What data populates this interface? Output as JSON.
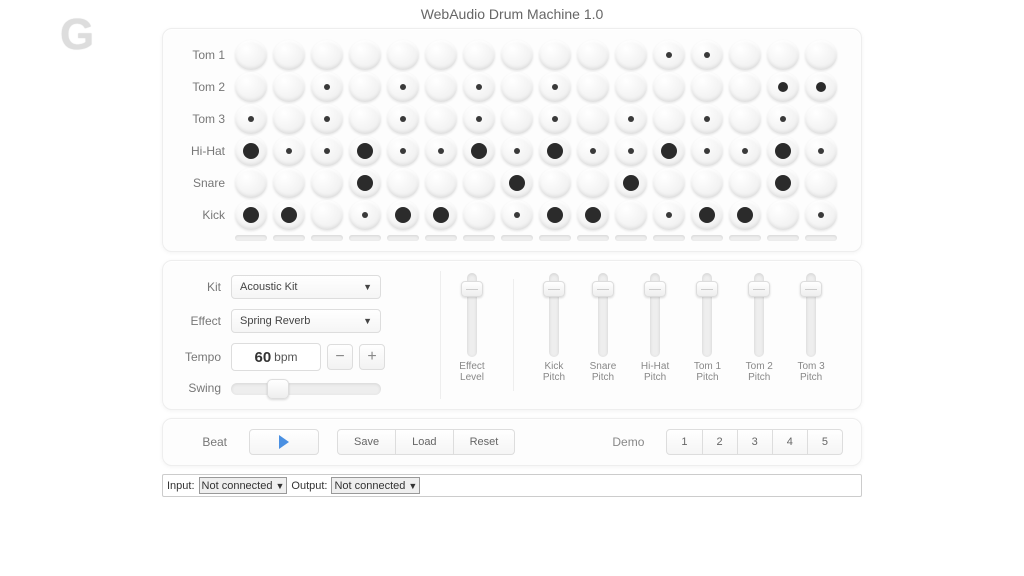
{
  "title": "WebAudio Drum Machine 1.0",
  "logo_char": "G",
  "tracks": [
    {
      "name": "Tom 1",
      "steps": [
        0,
        0,
        0,
        0,
        0,
        0,
        0,
        0,
        0,
        0,
        0,
        1,
        1,
        0,
        0,
        0
      ]
    },
    {
      "name": "Tom 2",
      "steps": [
        0,
        0,
        1,
        0,
        1,
        0,
        1,
        0,
        1,
        0,
        0,
        0,
        0,
        0,
        2,
        2
      ]
    },
    {
      "name": "Tom 3",
      "steps": [
        1,
        0,
        1,
        0,
        1,
        0,
        1,
        0,
        1,
        0,
        1,
        0,
        1,
        0,
        1,
        0
      ]
    },
    {
      "name": "Hi-Hat",
      "steps": [
        3,
        1,
        1,
        3,
        1,
        1,
        3,
        1,
        3,
        1,
        1,
        3,
        1,
        1,
        3,
        1
      ]
    },
    {
      "name": "Snare",
      "steps": [
        0,
        0,
        0,
        3,
        0,
        0,
        0,
        3,
        0,
        0,
        3,
        0,
        0,
        0,
        3,
        0
      ]
    },
    {
      "name": "Kick",
      "steps": [
        3,
        3,
        0,
        1,
        3,
        3,
        0,
        1,
        3,
        3,
        0,
        1,
        3,
        3,
        0,
        1
      ]
    }
  ],
  "controls": {
    "kit_label": "Kit",
    "kit_value": "Acoustic Kit",
    "effect_label": "Effect",
    "effect_value": "Spring Reverb",
    "tempo_label": "Tempo",
    "tempo_value": "60",
    "tempo_unit": "bpm",
    "swing_label": "Swing"
  },
  "sliders": [
    {
      "label": "Effect\nLevel"
    },
    {
      "label": "Kick\nPitch"
    },
    {
      "label": "Snare\nPitch"
    },
    {
      "label": "Hi-Hat\nPitch"
    },
    {
      "label": "Tom 1\nPitch"
    },
    {
      "label": "Tom 2\nPitch"
    },
    {
      "label": "Tom 3\nPitch"
    }
  ],
  "transport": {
    "beat_label": "Beat",
    "save": "Save",
    "load": "Load",
    "reset": "Reset",
    "demo_label": "Demo",
    "demos": [
      "1",
      "2",
      "3",
      "4",
      "5"
    ]
  },
  "io": {
    "input_label": "Input:",
    "input_value": "Not connected",
    "output_label": "Output:",
    "output_value": "Not connected"
  }
}
